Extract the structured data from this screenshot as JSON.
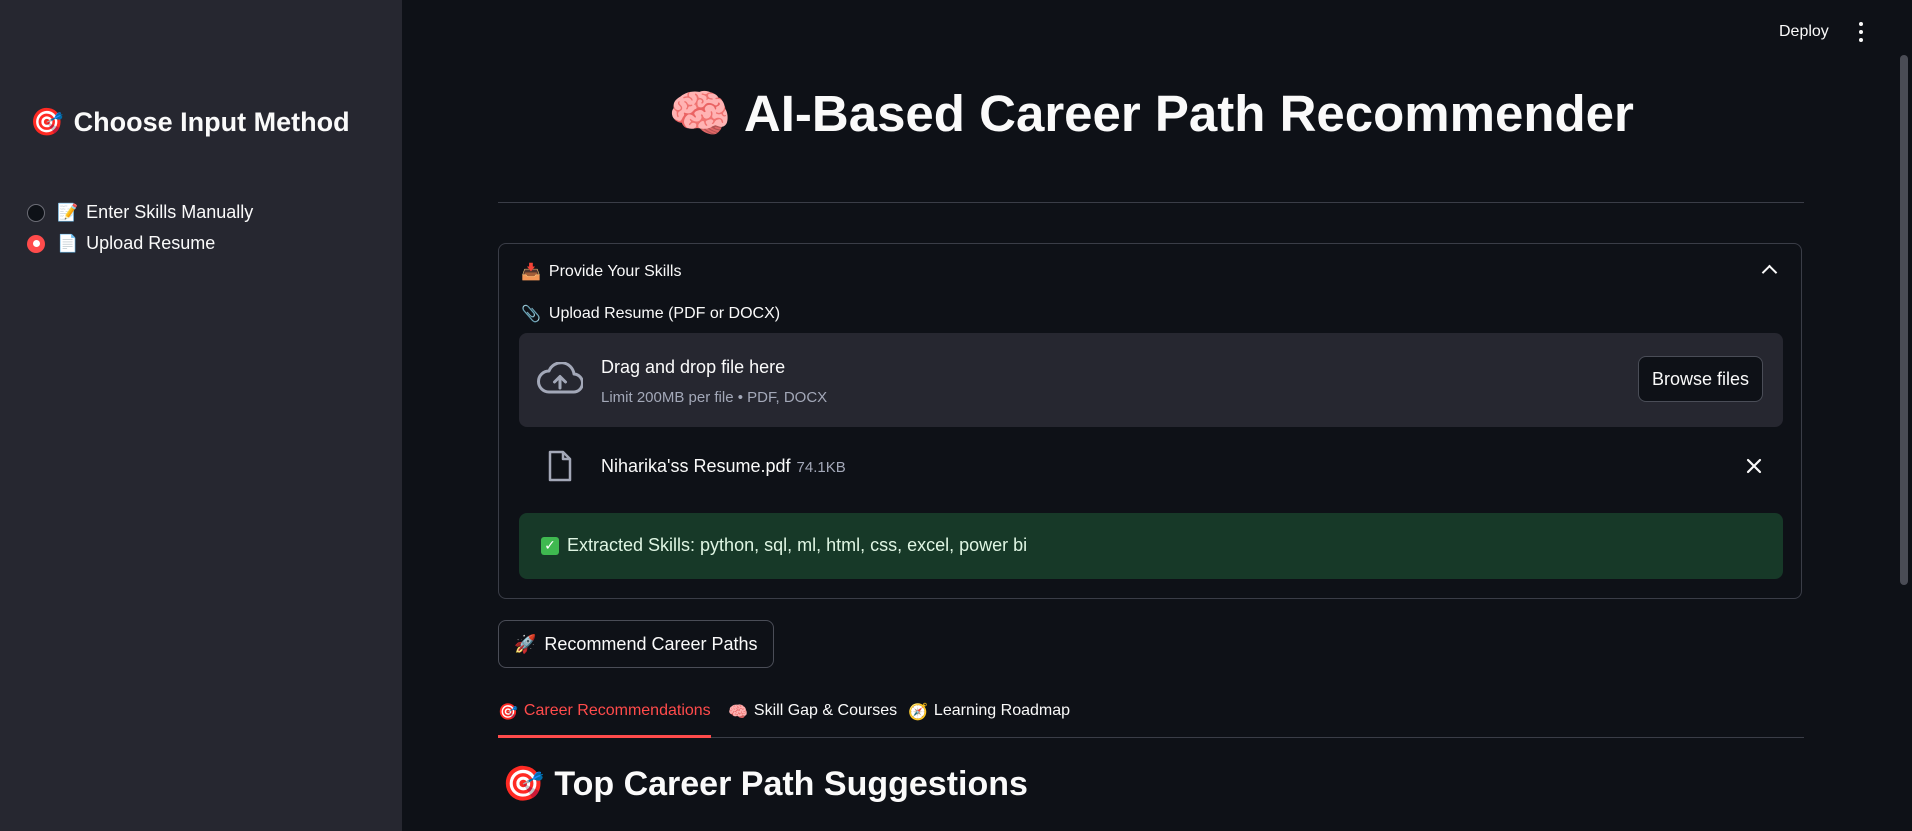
{
  "sidebar": {
    "title": "Choose Input Method",
    "title_icon": "dart-target-icon",
    "options": [
      {
        "label": "Enter Skills Manually",
        "icon": "memo-icon",
        "selected": false
      },
      {
        "label": "Upload Resume",
        "icon": "page-icon",
        "selected": true
      }
    ]
  },
  "topbar": {
    "deploy_label": "Deploy",
    "menu_icon": "kebab-menu-icon"
  },
  "main": {
    "title": "AI-Based Career Path Recommender",
    "title_icon": "brain-icon",
    "expander": {
      "header": "Provide Your Skills",
      "header_icon": "inbox-tray-icon",
      "expanded": true,
      "upload_label": "Upload Resume (PDF or DOCX)",
      "upload_icon": "paperclip-icon",
      "dropzone": {
        "title": "Drag and drop file here",
        "limit": "Limit 200MB per file • PDF, DOCX",
        "browse_label": "Browse files"
      },
      "file": {
        "name": "Niharika'ss Resume.pdf",
        "size": "74.1KB"
      },
      "success": {
        "text": "Extracted Skills: python, sql, ml, html, css, excel, power bi"
      }
    },
    "recommend_button": "Recommend Career Paths",
    "tabs": [
      {
        "label": "Career Recommendations",
        "icon": "dart-target-icon",
        "active": true
      },
      {
        "label": "Skill Gap & Courses",
        "icon": "brain-icon",
        "active": false
      },
      {
        "label": "Learning Roadmap",
        "icon": "compass-icon",
        "active": false
      }
    ],
    "section_heading": "Top Career Path Suggestions"
  },
  "colors": {
    "background": "#0e1117",
    "sidebar": "#262730",
    "accent": "#ff4b4b",
    "success_bg": "#173928"
  }
}
